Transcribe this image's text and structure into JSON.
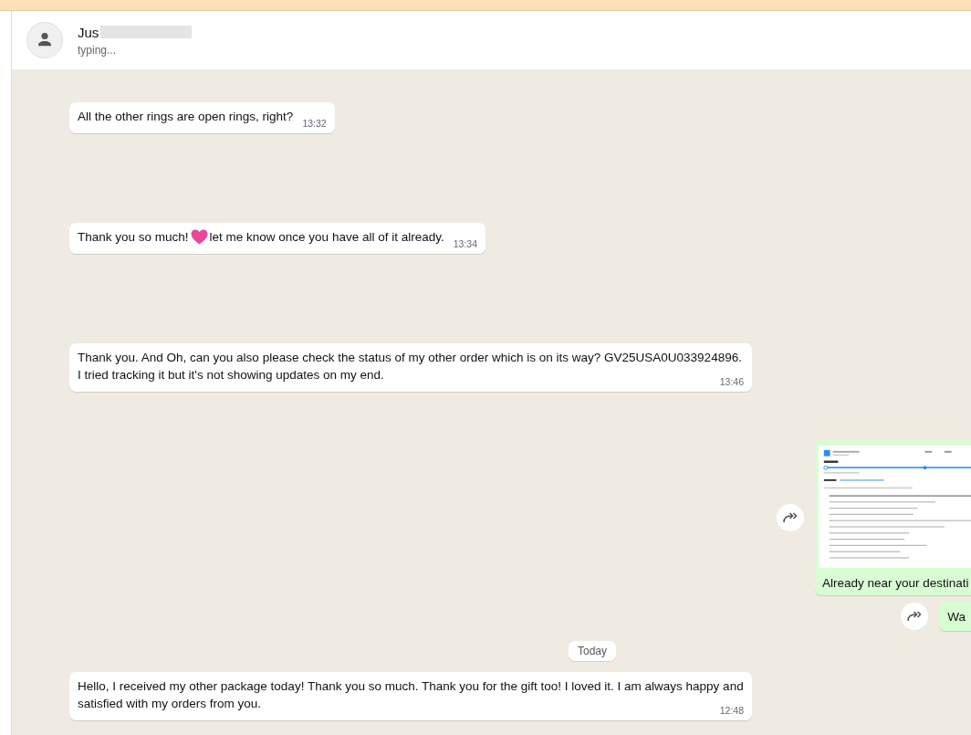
{
  "header": {
    "name": "Jus",
    "status": "typing..."
  },
  "messages": [
    {
      "kind": "text",
      "outgoing": false,
      "parts": [
        "All the other rings are open rings, right?"
      ],
      "time": "13:32"
    },
    {
      "kind": "text",
      "outgoing": false,
      "parts": [
        "Thank you so much!",
        "let me know once you have all of it already."
      ],
      "heart": true,
      "time": "13:34"
    },
    {
      "kind": "text",
      "outgoing": false,
      "parts": [
        "Thank you. And Oh, can you also please check the status of my other order which is on its way? GV25USA0U033924896. I tried tracking it but it's not showing updates on my end."
      ],
      "time": "13:46"
    },
    {
      "kind": "image",
      "outgoing": true,
      "parts": [
        "Already near your destinati"
      ]
    },
    {
      "kind": "text",
      "outgoing": true,
      "parts": [
        "Wa"
      ]
    },
    {
      "kind": "date",
      "parts": [
        "Today"
      ]
    },
    {
      "kind": "text",
      "outgoing": false,
      "parts": [
        "Hello, I received my other package today! Thank you so much. Thank you for the gift too! I loved it. I am always happy and satisfied with my orders from you."
      ],
      "time": "12:48"
    }
  ]
}
